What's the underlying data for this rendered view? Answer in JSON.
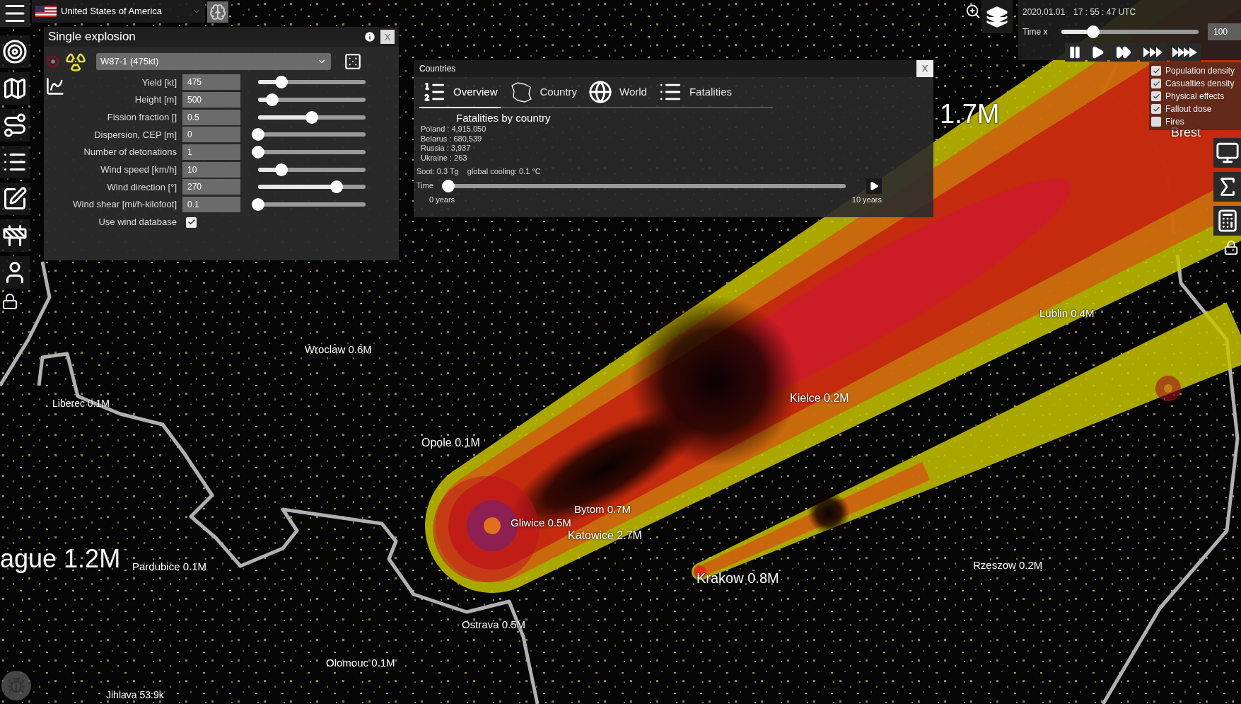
{
  "top_bar": {
    "country": "United States of America"
  },
  "explosion_panel": {
    "title": "Single explosion",
    "close": "X",
    "weapon": "W87-1 (475kt)",
    "params": [
      {
        "label": "Yield [kt]",
        "value": "475",
        "level": 0.22
      },
      {
        "label": "Height [m]",
        "value": "500",
        "level": 0.13
      },
      {
        "label": "Fission fraction []",
        "value": "0.5",
        "level": 0.5
      },
      {
        "label": "Dispersion, CEP [m]",
        "value": "0",
        "level": 0
      },
      {
        "label": "Number of detonations",
        "value": "1",
        "level": 0
      },
      {
        "label": "Wind speed [km/h]",
        "value": "10",
        "level": 0.22
      },
      {
        "label": "Wind direction [°]",
        "value": "270",
        "level": 0.73
      },
      {
        "label": "Wind shear [mi/h-kilofoot]",
        "value": "0.1",
        "level": 0
      }
    ],
    "wind_database": {
      "label": "Use wind database",
      "checked": true
    }
  },
  "countries_panel": {
    "title": "Countries",
    "close": "X",
    "tabs": [
      {
        "label": "Overview",
        "kind": "ranking",
        "selected": true
      },
      {
        "label": "Country",
        "kind": "outline",
        "selected": false
      },
      {
        "label": "World",
        "kind": "globe",
        "selected": false
      },
      {
        "label": "Fatalities",
        "kind": "list",
        "selected": false
      }
    ],
    "heading": "Fatalities by country",
    "rows": [
      "Poland : 4,915,050",
      "Belarus : 680,539",
      "Russia : 3,937",
      "Ukraine : 263"
    ],
    "soot": "Soot: 0.3 Tg",
    "cooling": "global cooling: 0.1 °C",
    "time_slider": {
      "label": "Time",
      "level": 0,
      "start": "0 years",
      "end": "10 years"
    }
  },
  "clock": {
    "date": "2020.01.01",
    "time": "17 : 55 : 47 UTC",
    "speed_label": "Time x",
    "level": 0.23,
    "speed": "100"
  },
  "layers": [
    {
      "label": "Population density",
      "checked": true
    },
    {
      "label": "Casualties density",
      "checked": true
    },
    {
      "label": "Physical effects",
      "checked": true
    },
    {
      "label": "Fallout dose",
      "checked": true
    },
    {
      "label": "Fires",
      "checked": false
    }
  ],
  "map_labels": [
    "Wroclaw 0.6M",
    "Liberec 0.1M",
    "Opole 0.1M",
    "Gliwice 0.5M",
    "Bytom 0.7M",
    "Katowice 2.7M",
    "ague 1.2M",
    "Pardubice 0.1M",
    "Krakow 0.8M",
    "Ostrava 0.5M",
    "Olomouc 0.1M",
    "Jihlava 53.9k",
    "Kielce 0.2M",
    "Lublin 0.4M",
    "Rzeszow 0.2M",
    "1.7M",
    "Brest"
  ]
}
